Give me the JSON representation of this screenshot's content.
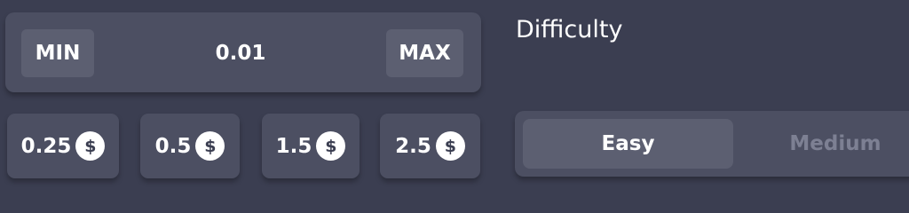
{
  "bet": {
    "min_label": "MIN",
    "max_label": "MAX",
    "amount": "0.01"
  },
  "quick_amounts": [
    {
      "label": "0.25",
      "icon": "$"
    },
    {
      "label": "0.5",
      "icon": "$"
    },
    {
      "label": "1.5",
      "icon": "$"
    },
    {
      "label": "2.5",
      "icon": "$"
    }
  ],
  "difficulty": {
    "title": "Difficulty",
    "options": [
      {
        "label": "Easy",
        "selected": true
      },
      {
        "label": "Medium",
        "selected": false
      }
    ]
  },
  "colors": {
    "background": "#3b3e51",
    "panel": "#4c4f62",
    "button": "#5c5f71",
    "inactive_text": "#7d8093"
  }
}
